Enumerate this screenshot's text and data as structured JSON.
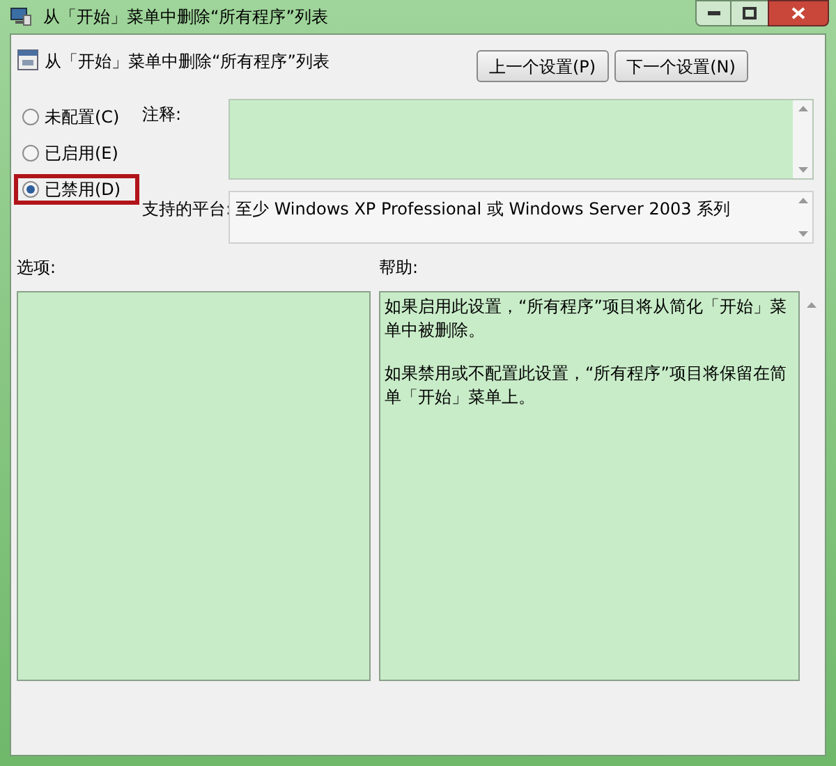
{
  "window": {
    "title": "从「开始」菜单中删除“所有程序”列表"
  },
  "header": {
    "title": "从「开始」菜单中删除“所有程序”列表",
    "buttons": [
      "上一个设置(P)",
      "下一个设置(N)"
    ]
  },
  "options": [
    {
      "label": "未配置(C)",
      "selected": false,
      "highlighted": false
    },
    {
      "label": "已启用(E)",
      "selected": false,
      "highlighted": false
    },
    {
      "label": "已禁用(D)",
      "selected": true,
      "highlighted": true
    }
  ],
  "comment": {
    "label": "注释:"
  },
  "platform": {
    "label": "支持的平台:",
    "value": "至少 Windows XP Professional 或 Windows Server 2003 系列"
  },
  "options_section": {
    "label": "选项:"
  },
  "help_section": {
    "label": "帮助:",
    "paragraphs": [
      "如果启用此设置，“所有程序”项目将从简化「开始」菜单中被删除。",
      "如果禁用或不配置此设置，“所有程序”项目将保留在简单「开始」菜单上。"
    ]
  }
}
